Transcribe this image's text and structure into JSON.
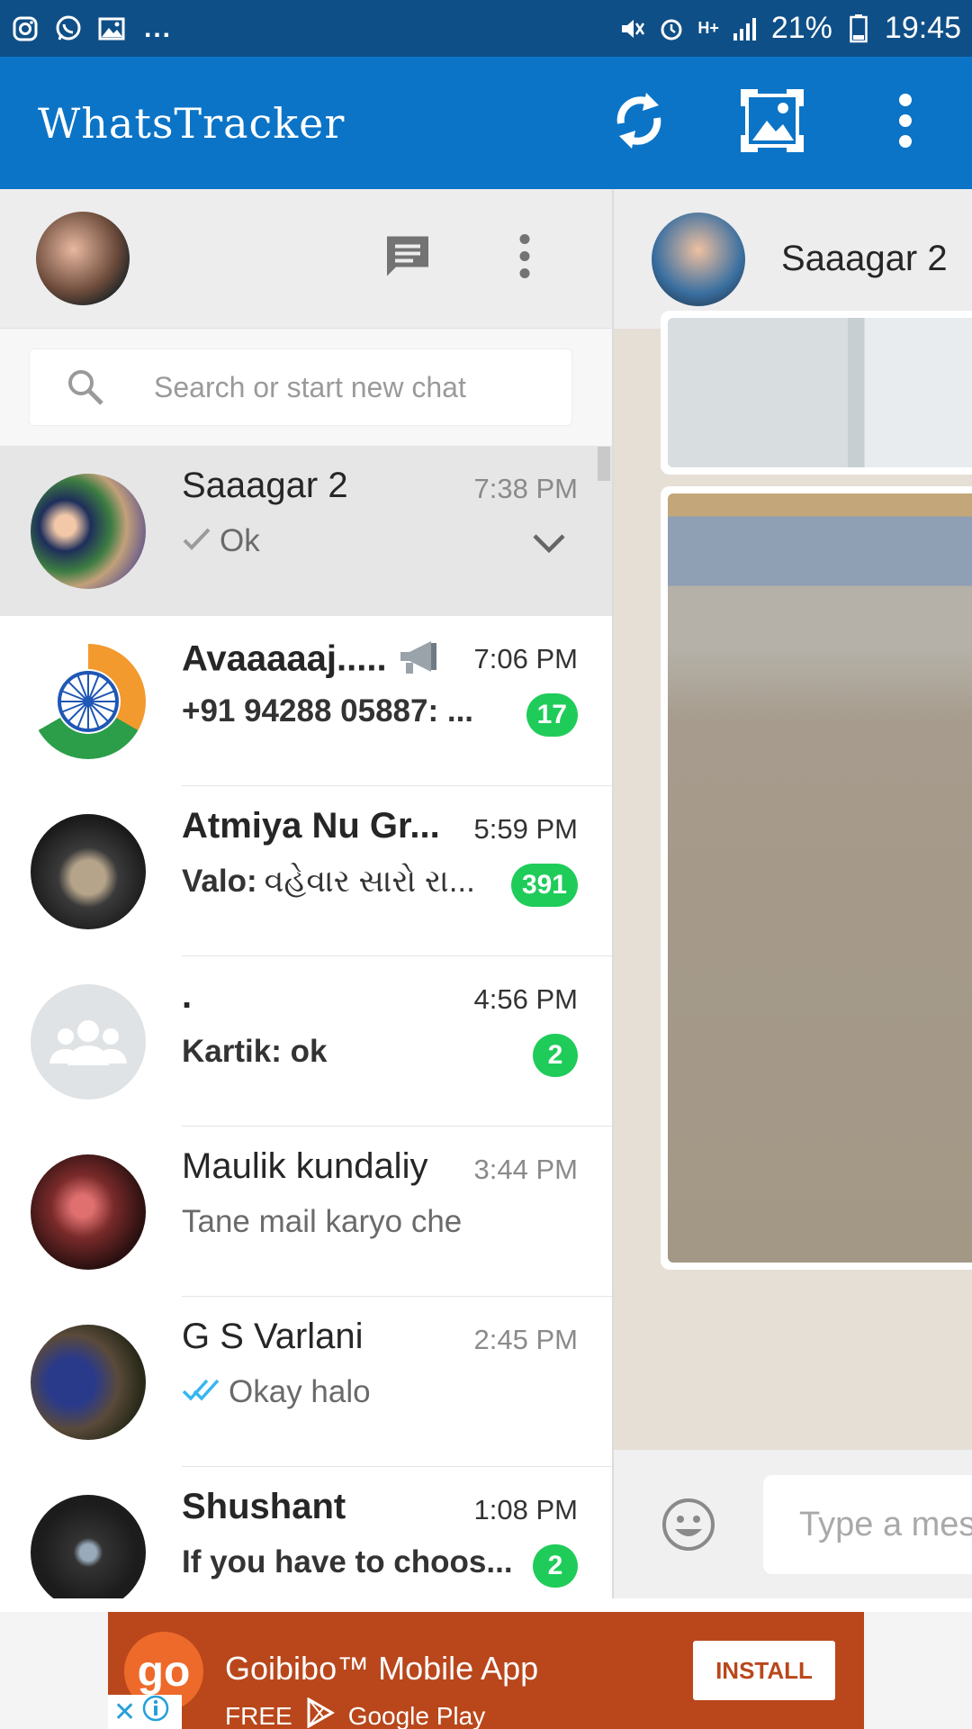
{
  "status_bar": {
    "battery": "21%",
    "time": "19:45",
    "overflow": "...",
    "network": "H+"
  },
  "app_bar": {
    "title": "WhatsTracker"
  },
  "left_panel": {
    "search_placeholder": "Search or start new chat"
  },
  "chats": [
    {
      "name": "Saaagar 2",
      "time": "7:38 PM",
      "message": "Ok",
      "tick": "single-tick-icon",
      "selected": true,
      "badge": ""
    },
    {
      "name": "Avaaaaaj.....",
      "time": "7:06 PM",
      "message": "+91 94288 05887: ...",
      "badge": "17",
      "bold": true
    },
    {
      "name": "Atmiya Nu Gr...",
      "time": "5:59 PM",
      "message_sender": "Valo:",
      "message": "વહેવાર સારો રા...",
      "badge": "391",
      "bold": true
    },
    {
      "name": ".",
      "time": "4:56 PM",
      "message": "Kartik: ok",
      "badge": "2",
      "bold": true
    },
    {
      "name": "Maulik kundaliy",
      "time": "3:44 PM",
      "message": "Tane mail karyo che",
      "badge": ""
    },
    {
      "name": "G S Varlani",
      "time": "2:45 PM",
      "message": "Okay halo",
      "tick": "double-tick-icon",
      "badge": ""
    },
    {
      "name": "Shushant",
      "time": "1:08 PM",
      "message": "If you have to choos...",
      "badge": "2",
      "bold": true
    }
  ],
  "conversation": {
    "contact_name": "Saaagar 2",
    "compose_placeholder": "Type a mes"
  },
  "ad": {
    "logo": "go",
    "title": "Goibibo™ Mobile App",
    "free": "FREE",
    "store": "Google Play",
    "install": "INSTALL"
  },
  "colors": {
    "status_bar": "#0f4f87",
    "app_bar": "#0b74c7",
    "badge": "#1fcc5a",
    "ad": "#b9471b"
  }
}
